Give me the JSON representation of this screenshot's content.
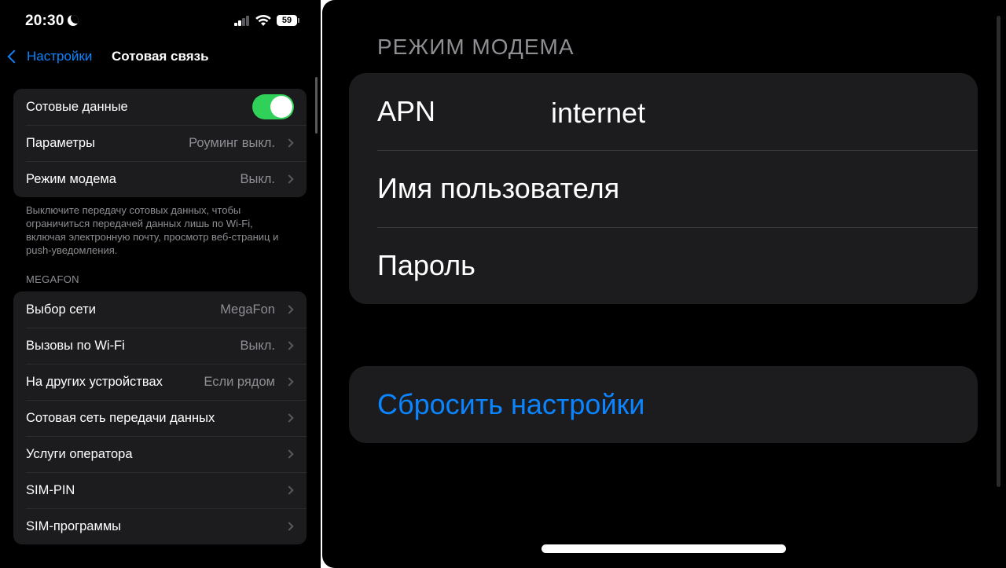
{
  "status_bar": {
    "time": "20:30",
    "battery": "59"
  },
  "nav": {
    "back_label": "Настройки",
    "title": "Сотовая связь"
  },
  "group1": [
    {
      "label": "Сотовые данные",
      "toggle": true
    },
    {
      "label": "Параметры",
      "value": "Роуминг выкл."
    },
    {
      "label": "Режим модема",
      "value": "Выкл."
    }
  ],
  "footnote": "Выключите передачу сотовых данных, чтобы ограничиться передачей данных лишь по Wi-Fi, включая электронную почту, просмотр веб-страниц и push-уведомления.",
  "section_header": "MEGAFON",
  "group2": [
    {
      "label": "Выбор сети",
      "value": "MegaFon"
    },
    {
      "label": "Вызовы по Wi-Fi",
      "value": "Выкл."
    },
    {
      "label": "На других устройствах",
      "value": "Если рядом"
    },
    {
      "label": "Сотовая сеть передачи данных",
      "value": ""
    },
    {
      "label": "Услуги оператора",
      "value": ""
    },
    {
      "label": "SIM-PIN",
      "value": ""
    },
    {
      "label": "SIM-программы",
      "value": ""
    }
  ],
  "modem": {
    "header": "РЕЖИМ МОДЕМА",
    "apn_label": "APN",
    "apn_value": "internet",
    "username_label": "Имя пользователя",
    "password_label": "Пароль",
    "reset_label": "Сбросить настройки"
  },
  "colors": {
    "accent": "#0a84ff",
    "toggle_on": "#30d158",
    "cell_bg": "#1c1c1e"
  }
}
